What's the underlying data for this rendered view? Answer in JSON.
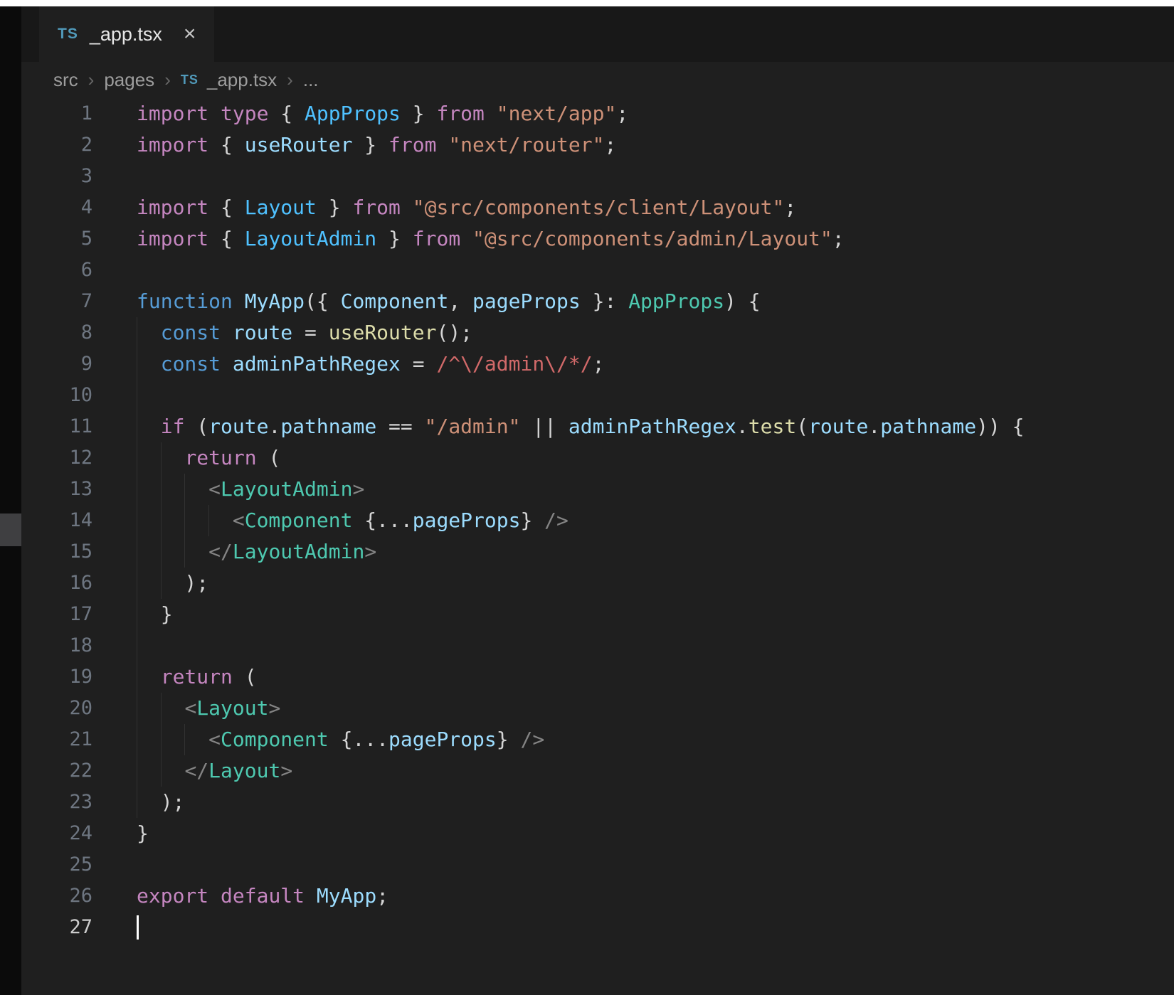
{
  "tab_bar": {
    "tabs": [
      {
        "label": "_app.tsx",
        "icon": "TS",
        "close": "×"
      }
    ]
  },
  "breadcrumb": {
    "items": [
      "src",
      "pages",
      "_app.tsx",
      "..."
    ],
    "separator": "›",
    "file_icon": "TS"
  },
  "editor": {
    "language": "typescriptreact",
    "colors": {
      "k": "#C586C0",
      "b": "#569CD6",
      "v": "#9CDCFE",
      "i": "#4FC1FF",
      "t": "#4EC9B0",
      "s": "#CE9178",
      "f": "#DCDCAA",
      "r": "#D16969",
      "w": "#D4D4D4",
      "g": "#848484"
    },
    "lines": [
      {
        "n": "1",
        "guides": [],
        "tokens": [
          [
            "k",
            "import"
          ],
          [
            "w",
            " "
          ],
          [
            "k",
            "type"
          ],
          [
            "w",
            " { "
          ],
          [
            "i",
            "AppProps"
          ],
          [
            "w",
            " } "
          ],
          [
            "k",
            "from"
          ],
          [
            "w",
            " "
          ],
          [
            "s",
            "\"next/app\""
          ],
          [
            "w",
            ";"
          ]
        ]
      },
      {
        "n": "2",
        "guides": [],
        "tokens": [
          [
            "k",
            "import"
          ],
          [
            "w",
            " { "
          ],
          [
            "v",
            "useRouter"
          ],
          [
            "w",
            " } "
          ],
          [
            "k",
            "from"
          ],
          [
            "w",
            " "
          ],
          [
            "s",
            "\"next/router\""
          ],
          [
            "w",
            ";"
          ]
        ]
      },
      {
        "n": "3",
        "guides": [],
        "tokens": []
      },
      {
        "n": "4",
        "guides": [],
        "tokens": [
          [
            "k",
            "import"
          ],
          [
            "w",
            " { "
          ],
          [
            "i",
            "Layout"
          ],
          [
            "w",
            " } "
          ],
          [
            "k",
            "from"
          ],
          [
            "w",
            " "
          ],
          [
            "s",
            "\"@src/components/client/Layout\""
          ],
          [
            "w",
            ";"
          ]
        ]
      },
      {
        "n": "5",
        "guides": [],
        "tokens": [
          [
            "k",
            "import"
          ],
          [
            "w",
            " { "
          ],
          [
            "i",
            "LayoutAdmin"
          ],
          [
            "w",
            " } "
          ],
          [
            "k",
            "from"
          ],
          [
            "w",
            " "
          ],
          [
            "s",
            "\"@src/components/admin/Layout\""
          ],
          [
            "w",
            ";"
          ]
        ]
      },
      {
        "n": "6",
        "guides": [],
        "tokens": []
      },
      {
        "n": "7",
        "guides": [],
        "tokens": [
          [
            "b",
            "function"
          ],
          [
            "w",
            " "
          ],
          [
            "v",
            "MyApp"
          ],
          [
            "w",
            "({ "
          ],
          [
            "v",
            "Component"
          ],
          [
            "w",
            ", "
          ],
          [
            "v",
            "pageProps"
          ],
          [
            "w",
            " }: "
          ],
          [
            "t",
            "AppProps"
          ],
          [
            "w",
            ") {"
          ]
        ]
      },
      {
        "n": "8",
        "guides": [
          0
        ],
        "tokens": [
          [
            "w",
            "  "
          ],
          [
            "b",
            "const"
          ],
          [
            "w",
            " "
          ],
          [
            "v",
            "route"
          ],
          [
            "w",
            " = "
          ],
          [
            "f",
            "useRouter"
          ],
          [
            "w",
            "();"
          ]
        ]
      },
      {
        "n": "9",
        "guides": [
          0
        ],
        "tokens": [
          [
            "w",
            "  "
          ],
          [
            "b",
            "const"
          ],
          [
            "w",
            " "
          ],
          [
            "v",
            "adminPathRegex"
          ],
          [
            "w",
            " = "
          ],
          [
            "r",
            "/^\\/admin\\/*/"
          ],
          [
            "w",
            ";"
          ]
        ]
      },
      {
        "n": "10",
        "guides": [
          0
        ],
        "tokens": []
      },
      {
        "n": "11",
        "guides": [
          0
        ],
        "tokens": [
          [
            "w",
            "  "
          ],
          [
            "k",
            "if"
          ],
          [
            "w",
            " ("
          ],
          [
            "v",
            "route"
          ],
          [
            "w",
            "."
          ],
          [
            "v",
            "pathname"
          ],
          [
            "w",
            " == "
          ],
          [
            "s",
            "\"/admin\""
          ],
          [
            "w",
            " || "
          ],
          [
            "v",
            "adminPathRegex"
          ],
          [
            "w",
            "."
          ],
          [
            "f",
            "test"
          ],
          [
            "w",
            "("
          ],
          [
            "v",
            "route"
          ],
          [
            "w",
            "."
          ],
          [
            "v",
            "pathname"
          ],
          [
            "w",
            ")) {"
          ]
        ]
      },
      {
        "n": "12",
        "guides": [
          0,
          2
        ],
        "tokens": [
          [
            "w",
            "    "
          ],
          [
            "k",
            "return"
          ],
          [
            "w",
            " ("
          ]
        ]
      },
      {
        "n": "13",
        "guides": [
          0,
          2,
          4
        ],
        "tokens": [
          [
            "w",
            "      "
          ],
          [
            "g",
            "<"
          ],
          [
            "t",
            "LayoutAdmin"
          ],
          [
            "g",
            ">"
          ]
        ]
      },
      {
        "n": "14",
        "guides": [
          0,
          2,
          4,
          6
        ],
        "tokens": [
          [
            "w",
            "        "
          ],
          [
            "g",
            "<"
          ],
          [
            "t",
            "Component"
          ],
          [
            "w",
            " {..."
          ],
          [
            "v",
            "pageProps"
          ],
          [
            "w",
            "} "
          ],
          [
            "g",
            "/>"
          ]
        ]
      },
      {
        "n": "15",
        "guides": [
          0,
          2,
          4
        ],
        "tokens": [
          [
            "w",
            "      "
          ],
          [
            "g",
            "</"
          ],
          [
            "t",
            "LayoutAdmin"
          ],
          [
            "g",
            ">"
          ]
        ]
      },
      {
        "n": "16",
        "guides": [
          0,
          2
        ],
        "tokens": [
          [
            "w",
            "    );"
          ]
        ]
      },
      {
        "n": "17",
        "guides": [
          0
        ],
        "tokens": [
          [
            "w",
            "  }"
          ]
        ]
      },
      {
        "n": "18",
        "guides": [
          0
        ],
        "tokens": []
      },
      {
        "n": "19",
        "guides": [
          0
        ],
        "tokens": [
          [
            "w",
            "  "
          ],
          [
            "k",
            "return"
          ],
          [
            "w",
            " ("
          ]
        ]
      },
      {
        "n": "20",
        "guides": [
          0,
          2
        ],
        "tokens": [
          [
            "w",
            "    "
          ],
          [
            "g",
            "<"
          ],
          [
            "t",
            "Layout"
          ],
          [
            "g",
            ">"
          ]
        ]
      },
      {
        "n": "21",
        "guides": [
          0,
          2,
          4
        ],
        "tokens": [
          [
            "w",
            "      "
          ],
          [
            "g",
            "<"
          ],
          [
            "t",
            "Component"
          ],
          [
            "w",
            " {..."
          ],
          [
            "v",
            "pageProps"
          ],
          [
            "w",
            "} "
          ],
          [
            "g",
            "/>"
          ]
        ]
      },
      {
        "n": "22",
        "guides": [
          0,
          2
        ],
        "tokens": [
          [
            "w",
            "    "
          ],
          [
            "g",
            "</"
          ],
          [
            "t",
            "Layout"
          ],
          [
            "g",
            ">"
          ]
        ]
      },
      {
        "n": "23",
        "guides": [
          0
        ],
        "tokens": [
          [
            "w",
            "  );"
          ]
        ]
      },
      {
        "n": "24",
        "guides": [],
        "tokens": [
          [
            "w",
            "}"
          ]
        ]
      },
      {
        "n": "25",
        "guides": [],
        "tokens": []
      },
      {
        "n": "26",
        "guides": [],
        "tokens": [
          [
            "k",
            "export"
          ],
          [
            "w",
            " "
          ],
          [
            "k",
            "default"
          ],
          [
            "w",
            " "
          ],
          [
            "v",
            "MyApp"
          ],
          [
            "w",
            ";"
          ]
        ]
      },
      {
        "n": "27",
        "guides": [],
        "tokens": [],
        "cursor": true
      }
    ]
  }
}
